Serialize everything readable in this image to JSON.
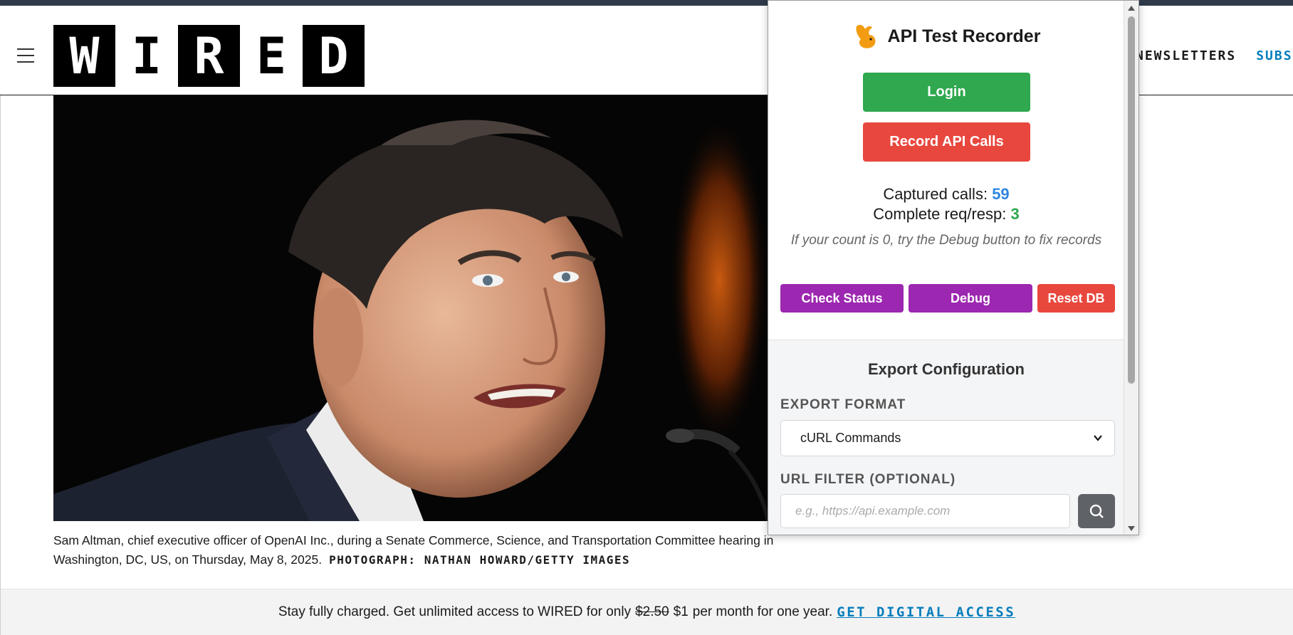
{
  "site": {
    "logo_letters": [
      "W",
      "I",
      "R",
      "E",
      "D"
    ],
    "nav": {
      "newsletters": "NEWSLETTERS",
      "subscribe": "SUBS"
    }
  },
  "article": {
    "caption_line1": "Sam Altman, chief executive officer of OpenAI Inc., during a Senate Commerce, Science, and Transportation Committee hearing in",
    "caption_line2": "Washington, DC, US, on Thursday, May 8, 2025.",
    "credit": "PHOTOGRAPH: NATHAN HOWARD/GETTY IMAGES"
  },
  "paywall": {
    "text_before": "Stay fully charged. Get unlimited access to WIRED for only",
    "old_price": "$2.50",
    "new_price": "$1",
    "text_after": "per month for one year.",
    "cta": "GET DIGITAL ACCESS"
  },
  "extension": {
    "title": "API Test Recorder",
    "icon": "rabbit-icon",
    "login_label": "Login",
    "record_label": "Record API Calls",
    "captured_label": "Captured calls:",
    "captured_value": "59",
    "complete_label": "Complete req/resp:",
    "complete_value": "3",
    "hint": "If your count is 0, try the Debug button to fix records",
    "check_status_label": "Check Status",
    "debug_label": "Debug",
    "reset_label": "Reset DB",
    "export": {
      "title": "Export Configuration",
      "format_label": "EXPORT FORMAT",
      "format_value": "cURL Commands",
      "filter_label": "URL FILTER (OPTIONAL)",
      "filter_placeholder": "e.g., https://api.example.com",
      "search_icon": "search-icon"
    },
    "colors": {
      "green": "#2fa84f",
      "red": "#e8473e",
      "purple": "#9c27b0",
      "blue": "#2f86e0"
    }
  }
}
